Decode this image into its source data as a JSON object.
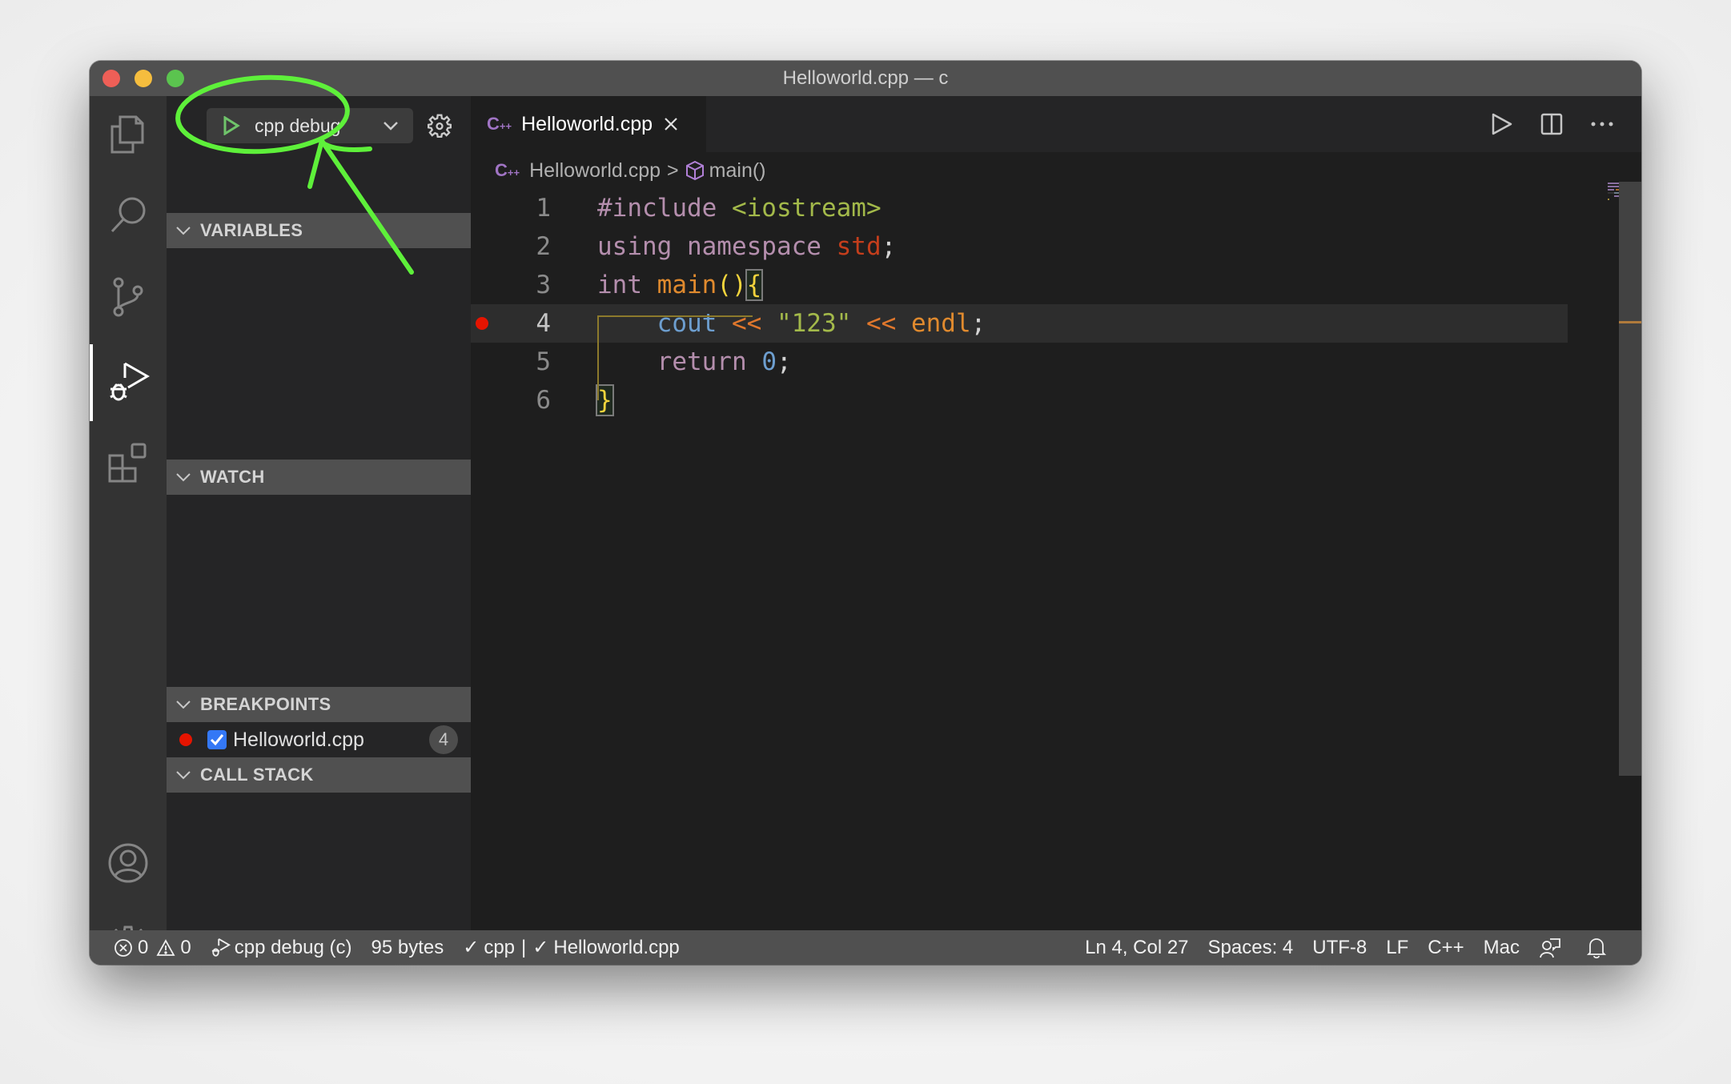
{
  "window": {
    "title": "Helloworld.cpp — c"
  },
  "activity_bar": {
    "items": [
      {
        "name": "explorer",
        "icon": "files-icon"
      },
      {
        "name": "search",
        "icon": "search-icon"
      },
      {
        "name": "source-control",
        "icon": "source-control-icon"
      },
      {
        "name": "run-and-debug",
        "icon": "debug-icon",
        "active": true
      },
      {
        "name": "extensions",
        "icon": "extensions-icon"
      }
    ],
    "bottom_items": [
      {
        "name": "accounts",
        "icon": "account-icon"
      },
      {
        "name": "manage",
        "icon": "gear-icon"
      }
    ]
  },
  "sidebar": {
    "debug_config": "cpp debug",
    "sections": {
      "variables": "VARIABLES",
      "watch": "WATCH",
      "breakpoints": "BREAKPOINTS",
      "call_stack": "CALL STACK"
    },
    "breakpoints": [
      {
        "file": "Helloworld.cpp",
        "line": "4",
        "enabled": true
      }
    ]
  },
  "editor": {
    "tab": {
      "icon_text": "C",
      "icon_sup": "++",
      "label": "Helloworld.cpp"
    },
    "breadcrumb": {
      "file": "Helloworld.cpp",
      "separator": ">",
      "symbol": "main()"
    },
    "lines": [
      {
        "n": "1",
        "tokens": [
          [
            "kw",
            "#include "
          ],
          [
            "str",
            "<iostream>"
          ]
        ]
      },
      {
        "n": "2",
        "tokens": [
          [
            "kw",
            "using namespace "
          ],
          [
            "ns",
            "std"
          ],
          [
            "pl",
            ";"
          ]
        ]
      },
      {
        "n": "3",
        "tokens": [
          [
            "kw",
            "int "
          ],
          [
            "fn",
            "main"
          ],
          [
            "br",
            "()"
          ],
          [
            "br bracket-match",
            "{"
          ]
        ]
      },
      {
        "n": "4",
        "tokens": [
          [
            "pl",
            "    "
          ],
          [
            "var",
            "cout"
          ],
          [
            "op",
            " << "
          ],
          [
            "str",
            "\"123\""
          ],
          [
            "op",
            " << "
          ],
          [
            "fn",
            "endl"
          ],
          [
            "pl",
            ";"
          ]
        ],
        "breakpoint": true,
        "current": true
      },
      {
        "n": "5",
        "tokens": [
          [
            "pl",
            "    "
          ],
          [
            "kw",
            "return "
          ],
          [
            "num",
            "0"
          ],
          [
            "pl",
            ";"
          ]
        ]
      },
      {
        "n": "6",
        "tokens": [
          [
            "br bracket-match",
            "}"
          ]
        ]
      }
    ]
  },
  "status_bar": {
    "errors": "0",
    "warnings": "0",
    "debug_config": "cpp debug (c)",
    "file_size": "95 bytes",
    "lang_status": "cpp",
    "lang_sep": "|",
    "file_status": "Helloworld.cpp",
    "cursor": "Ln 4, Col 27",
    "indent": "Spaces: 4",
    "encoding": "UTF-8",
    "eol": "LF",
    "language": "C++",
    "platform": "Mac"
  },
  "colors": {
    "annotation": "#5ef03a",
    "breakpoint": "#e51400",
    "checkbox": "#3478f6",
    "accent_purple": "#a074c4"
  }
}
